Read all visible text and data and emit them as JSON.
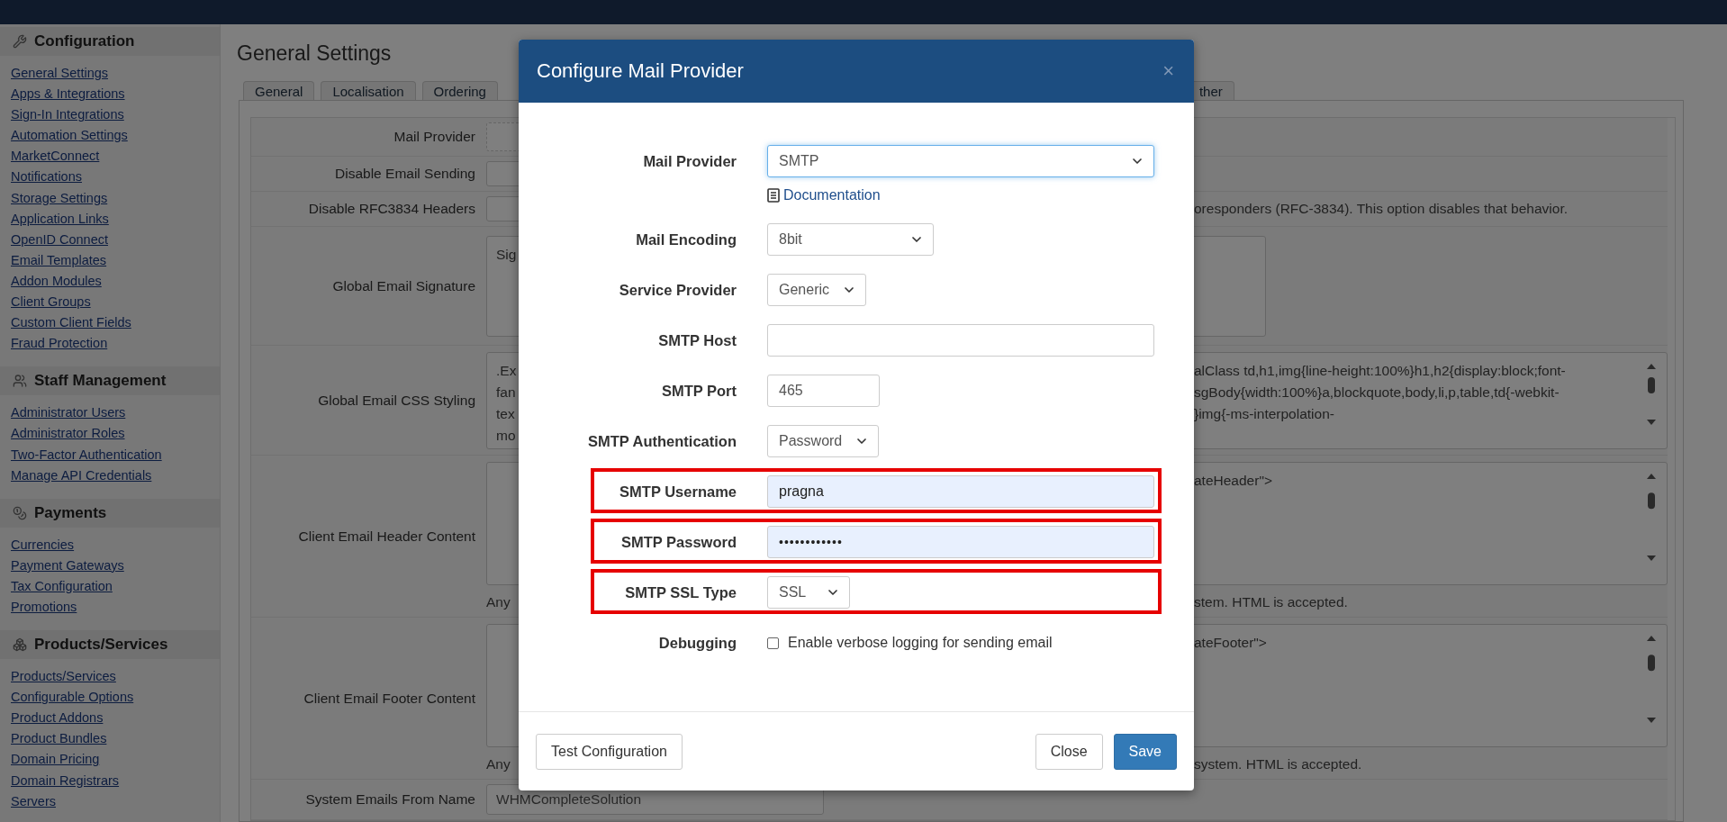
{
  "sidebar": {
    "sections": [
      {
        "title": "Configuration",
        "links": [
          "General Settings",
          "Apps & Integrations",
          "Sign-In Integrations",
          "Automation Settings",
          "MarketConnect",
          "Notifications",
          "Storage Settings",
          "Application Links",
          "OpenID Connect",
          "Email Templates",
          "Addon Modules",
          "Client Groups",
          "Custom Client Fields",
          "Fraud Protection"
        ]
      },
      {
        "title": "Staff Management",
        "links": [
          "Administrator Users",
          "Administrator Roles",
          "Two-Factor Authentication",
          "Manage API Credentials"
        ]
      },
      {
        "title": "Payments",
        "links": [
          "Currencies",
          "Payment Gateways",
          "Tax Configuration",
          "Promotions"
        ]
      },
      {
        "title": "Products/Services",
        "links": [
          "Products/Services",
          "Configurable Options",
          "Product Addons",
          "Product Bundles",
          "Domain Pricing",
          "Domain Registrars",
          "Servers"
        ]
      }
    ]
  },
  "page": {
    "title": "General Settings",
    "tabs": [
      {
        "label": "General",
        "selected": false
      },
      {
        "label": "Localisation",
        "selected": false
      },
      {
        "label": "Ordering",
        "selected": false
      },
      {
        "label": "ther",
        "selected": false
      }
    ],
    "settings": [
      {
        "label": "Mail Provider",
        "kind": "select"
      },
      {
        "label": "Disable Email Sending",
        "kind": "checkbox"
      },
      {
        "label": "Disable RFC3834 Headers",
        "kind": "checkbox",
        "note_right": "oresponders (RFC-3834). This option disables that behavior."
      },
      {
        "label": "Global Email Signature",
        "kind": "textarea",
        "lines_left": [
          "Sig"
        ]
      },
      {
        "label": "Global Email CSS Styling",
        "kind": "code",
        "lines_left": [
          ".Ex",
          "fan",
          "tex",
          "mo"
        ],
        "lines_right": [
          "alClass td,h1,img{line-height:100%}h1,h2{display:block;font-",
          "sgBody{width:100%}a,blockquote,body,li,p,table,td{-webkit-",
          "}img{-ms-interpolation-"
        ]
      },
      {
        "label": "Client Email Header Content",
        "kind": "template",
        "lines_right": [
          "ateHeader\">"
        ],
        "note_left": "Any",
        "note_right": "stem. HTML is accepted."
      },
      {
        "label": "Client Email Footer Content",
        "kind": "template",
        "lines_right": [
          "ateFooter\">"
        ],
        "note_left": "Any",
        "note_right": "system. HTML is accepted."
      },
      {
        "label": "System Emails From Name",
        "kind": "input",
        "value": "WHMCompleteSolution"
      }
    ]
  },
  "modal": {
    "title": "Configure Mail Provider",
    "close": "×",
    "fields": [
      {
        "label": "Mail Provider",
        "kind": "select",
        "value": "SMTP",
        "focused": true,
        "autofilled": false,
        "highlighted": false
      },
      {
        "kind": "link",
        "text": "Documentation"
      },
      {
        "label": "Mail Encoding",
        "kind": "select",
        "value": "8bit",
        "focused": false,
        "autofilled": false,
        "highlighted": false
      },
      {
        "label": "Service Provider",
        "kind": "select",
        "value": "Generic",
        "focused": false,
        "autofilled": false,
        "highlighted": false
      },
      {
        "label": "SMTP Host",
        "kind": "input",
        "focused": false,
        "autofilled": false,
        "highlighted": false
      },
      {
        "label": "SMTP Port",
        "kind": "input",
        "value": "465",
        "focused": false,
        "autofilled": false,
        "highlighted": false
      },
      {
        "label": "SMTP Authentication",
        "kind": "select",
        "value": "Password",
        "focused": false,
        "autofilled": false,
        "highlighted": false
      },
      {
        "label": "SMTP Username",
        "kind": "input",
        "value": "pragna",
        "focused": false,
        "autofilled": true,
        "highlighted": true
      },
      {
        "label": "SMTP Password",
        "kind": "password",
        "value": "••••••••••••",
        "focused": false,
        "autofilled": true,
        "highlighted": true
      },
      {
        "label": "SMTP SSL Type",
        "kind": "select",
        "value": "SSL",
        "focused": false,
        "autofilled": false,
        "highlighted": true
      },
      {
        "label": "Debugging",
        "kind": "checkbox",
        "text": "Enable verbose logging for sending email",
        "checked": false
      }
    ],
    "footer_left": [
      {
        "label": "Test Configuration",
        "kind": "default"
      }
    ],
    "footer_right": [
      {
        "label": "Close",
        "kind": "default"
      },
      {
        "label": "Save",
        "kind": "primary"
      }
    ]
  }
}
